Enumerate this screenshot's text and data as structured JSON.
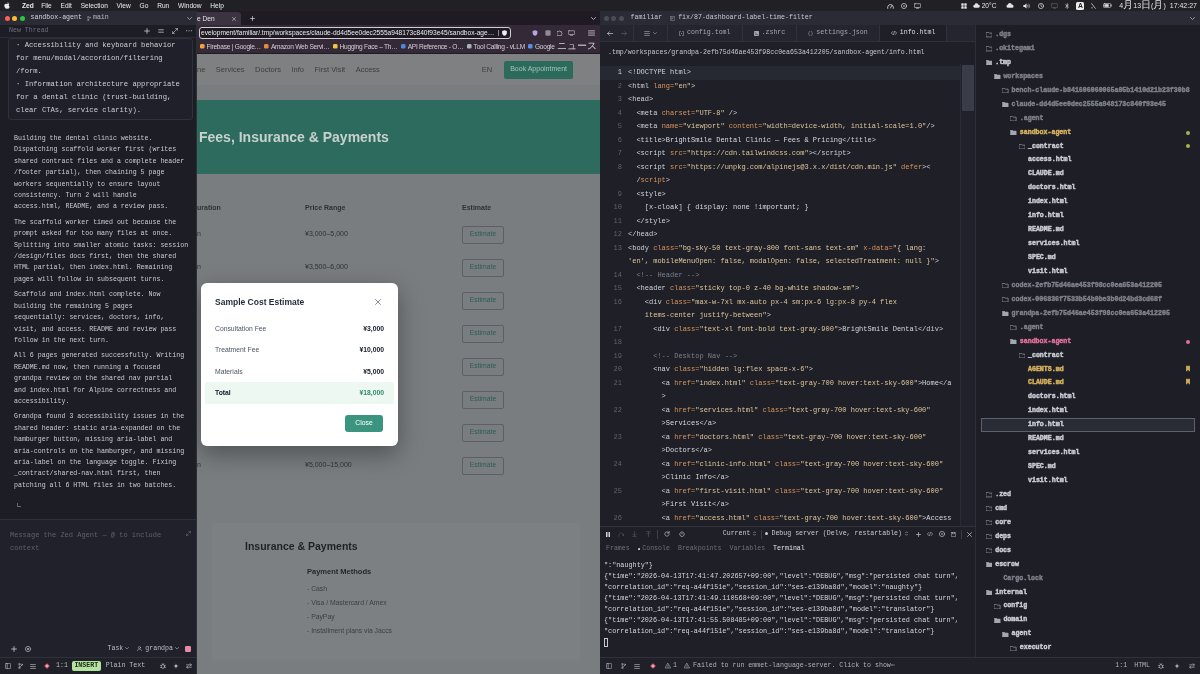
{
  "menu_bar": {
    "app_name": "Zed",
    "menus": [
      "File",
      "Edit",
      "Selection",
      "View",
      "Go",
      "Run",
      "Window",
      "Help"
    ],
    "weather": "20°C",
    "input_source": "A",
    "date": "4月13日(月)",
    "time": "17:42:27"
  },
  "agent_panel": {
    "title_bar": {
      "focused": true,
      "project": "sandbox-agent",
      "branch": "main"
    },
    "thread_title": "New Thread",
    "user_message": "· Accessibility and keyboard behavior\nfor menu/modal/accordion/filtering\n/form.\n· Information architecture appropriate\nfor a dental clinic (trust-building,\nclear CTAs, service clarity).",
    "messages": [
      "Building the dental clinic website.\nDispatching scaffold worker first (writes\nshared contract files and a complete header\n/footer partial), then chaining 5 page\nworkers sequentially to ensure layout\nconsistency. Turn 2 will handle\naccess.html, README, and a review pass.",
      "The scaffold worker timed out because the\nprompt asked for too many files at once.\nSplitting into smaller atomic tasks: session\n/design/files docs first, then the shared\nHTML partial, then index.html. Remaining\npages will follow in subsequent turns.",
      "Scaffold and index.html complete. Now\nbuilding the remaining 5 pages\nsequentially: services, doctors, info,\nvisit, and access. README and review pass\nfollow in the next turn.",
      "All 6 pages generated successfully. Writing\nREADME.md now, then running a focused\ngrandpa review on the shared nav partial\nand index.html for Alpine correctness and\naccessibility.",
      "Grandpa found 3 accessibility issues in the\nshared header: static aria-expanded on the\nhamburger button, missing aria-label and\naria-controls on the hamburger, and missing\naria-label on the language toggle. Fixing\n_contract/shared-nav.html first, then\npatching all 6 HTML files in two batches."
    ],
    "input": {
      "placeholder": "Message the Zed Agent — @ to include context"
    },
    "mode": "Task",
    "profile": "grandpa",
    "status_bar": {
      "position": "1:1",
      "vim_mode": "INSERT",
      "language": "Plain Text"
    }
  },
  "browser": {
    "tab_title": "e Den",
    "url": "evelopment/familiar/.tmp/workspaces/claude-dd4d5ee0dec2555a948173c840f93e45/sandbox-age…",
    "bookmarks": [
      {
        "label": "Firebase | Google…",
        "color": "#f2a33a"
      },
      {
        "label": "Amazon Web Servi…",
        "color": "#e8883a"
      },
      {
        "label": "Hugging Face – Th…",
        "color": "#f3c340"
      },
      {
        "label": "API Reference - O…",
        "color": "#4f86e0"
      },
      {
        "label": "Tool Calling - vLLM",
        "color": "#a9b1bb"
      },
      {
        "label": "Google ニュース",
        "color": "#5a8fe8"
      }
    ],
    "page": {
      "nav_links": [
        "ne",
        "Services",
        "Doctors",
        "Info",
        "First Visit",
        "Access"
      ],
      "language": "EN",
      "cta": "Book Appointment",
      "hero_title": "Fees, Insurance & Payments",
      "table": {
        "columns": [
          "uration",
          "Price Range",
          "Estimate"
        ],
        "rows": [
          {
            "column_1": "n",
            "price": "¥3,000–5,000",
            "action": "Estimate"
          },
          {
            "column_1": "n",
            "price": "¥3,500–6,000",
            "action": "Estimate"
          },
          {
            "action": "Estimate"
          },
          {
            "action": "Estimate"
          },
          {
            "action": "Estimate"
          },
          {
            "action": "Estimate"
          },
          {
            "action": "Estimate"
          },
          {
            "column_1": "n",
            "price": "¥5,000–15,000",
            "action": "Estimate"
          }
        ]
      },
      "payments": {
        "title": "Insurance & Payments",
        "subtitle": "Payment Methods",
        "items": [
          "- Cash",
          "- Visa / Mastercard / Amex",
          "- PayPay",
          "- Installment plans via Jaccs"
        ]
      }
    },
    "modal": {
      "title": "Sample Cost Estimate",
      "items": [
        {
          "kind": "item",
          "label": "Consultation Fee",
          "value": "¥3,000"
        },
        {
          "kind": "item",
          "label": "Treatment Fee",
          "value": "¥10,000"
        },
        {
          "kind": "item",
          "label": "Materials",
          "value": "¥5,000"
        },
        {
          "kind": "total",
          "label": "Total",
          "value": "¥18,000"
        }
      ],
      "button": "Close"
    }
  },
  "editor": {
    "title_bar": {
      "focused": false,
      "project": "familiar",
      "branch": "fix/87-dashboard-label-time-filter"
    },
    "tabs": [
      {
        "label": "config.toml",
        "kind": "config",
        "selected": false
      },
      {
        "label": ".zshrc",
        "kind": "shell",
        "selected": false
      },
      {
        "label": "settings.json",
        "kind": "json",
        "selected": false
      },
      {
        "label": "info.html",
        "kind": "html",
        "selected": true
      }
    ],
    "breadcrumb": ".tmp/workspaces/grandpa-2efb75d46ae453f98cc0ea653a412205/sandbox-agent/info.html",
    "code_lines": [
      {
        "number": "1",
        "current": true,
        "rows": [
          "<!DOCTYPE html>"
        ]
      },
      {
        "number": "2",
        "current": false,
        "rows": [
          "<html lang=\"en\">"
        ]
      },
      {
        "number": "3",
        "current": false,
        "rows": [
          "<head>"
        ]
      },
      {
        "number": "4",
        "current": false,
        "rows": [
          "  <meta charset=\"UTF-8\" />"
        ]
      },
      {
        "number": "5",
        "current": false,
        "rows": [
          "  <meta name=\"viewport\" content=\"width=device-width, initial-scale=1.0\"/>"
        ]
      },
      {
        "number": "6",
        "current": false,
        "rows": [
          "  <title>BrightSmile Dental Clinic — Fees & Pricing</title>"
        ]
      },
      {
        "number": "7",
        "current": false,
        "rows": [
          "  <script src=\"https://cdn.tailwindcss.com\"></script>"
        ]
      },
      {
        "number": "8",
        "current": false,
        "rows": [
          "  <script src=\"https://unpkg.com/alpinejs@3.x.x/dist/cdn.min.js\" defer><",
          "  /script>"
        ]
      },
      {
        "number": "9",
        "current": false,
        "rows": [
          "  <style>"
        ]
      },
      {
        "number": "10",
        "current": false,
        "rows": [
          "    [x-cloak] { display: none !important; }"
        ]
      },
      {
        "number": "11",
        "current": false,
        "rows": [
          "  </style>"
        ]
      },
      {
        "number": "12",
        "current": false,
        "rows": [
          "</head>"
        ]
      },
      {
        "number": "13",
        "current": false,
        "rows": [
          "<body class=\"bg-sky-50 text-gray-800 font-sans text-sm\" x-data=\"{ lang:",
          "'en', mobileMenuOpen: false, modalOpen: false, selectedTreatment: null }\">"
        ]
      },
      {
        "number": "14",
        "current": false,
        "rows": [
          "  <!-- Header -->"
        ]
      },
      {
        "number": "15",
        "current": false,
        "rows": [
          "  <header class=\"sticky top-0 z-40 bg-white shadow-sm\">"
        ]
      },
      {
        "number": "16",
        "current": false,
        "rows": [
          "    <div class=\"max-w-7xl mx-auto px-4 sm:px-6 lg:px-8 py-4 flex",
          "    items-center justify-between\">"
        ]
      },
      {
        "number": "17",
        "current": false,
        "rows": [
          "      <div class=\"text-xl font-bold text-gray-900\">BrightSmile Dental</div>"
        ]
      },
      {
        "number": "18",
        "current": false
      },
      {
        "number": "19",
        "current": false,
        "rows": [
          "      <!-- Desktop Nav -->"
        ]
      },
      {
        "number": "20",
        "current": false,
        "rows": [
          "      <nav class=\"hidden lg:flex space-x-6\">"
        ]
      },
      {
        "number": "21",
        "current": false,
        "rows": [
          "        <a href=\"index.html\" class=\"text-gray-700 hover:text-sky-600\">Home</a",
          "        >"
        ]
      },
      {
        "number": "22",
        "current": false,
        "rows": [
          "        <a href=\"services.html\" class=\"text-gray-700 hover:text-sky-600\"",
          "        >Services</a>"
        ]
      },
      {
        "number": "23",
        "current": false,
        "rows": [
          "        <a href=\"doctors.html\" class=\"text-gray-700 hover:text-sky-600\"",
          "        >Doctors</a>"
        ]
      },
      {
        "number": "24",
        "current": false,
        "rows": [
          "        <a href=\"clinic-info.html\" class=\"text-gray-700 hover:text-sky-600\"",
          "        >Clinic Info</a>"
        ]
      },
      {
        "number": "25",
        "current": false,
        "rows": [
          "        <a href=\"first-visit.html\" class=\"text-gray-700 hover:text-sky-600\"",
          "        >First Visit</a>"
        ]
      },
      {
        "number": "26",
        "current": false,
        "rows": [
          "        <a href=\"access.html\" class=\"text-gray-700 hover:text-sky-600\">Access"
        ]
      }
    ],
    "debug": {
      "session": "Current",
      "server": "Debug server (Delve, restartable)",
      "tabs": [
        {
          "label": "Frames",
          "dot": false,
          "selected": false
        },
        {
          "label": "Console",
          "dot": true,
          "selected": false
        },
        {
          "label": "Breakpoints",
          "dot": false,
          "selected": false
        },
        {
          "label": "Variables",
          "dot": false,
          "selected": false
        },
        {
          "label": "Terminal",
          "dot": false,
          "selected": true
        }
      ],
      "terminal_lines": [
        "\":\"naughty\"}",
        "{\"time\":\"2026-04-13T17:41:47.202657+09:00\",\"level\":\"DEBUG\",\"msg\":\"persisted chat turn\",",
        "\"correlation_id\":\"req-a44f151e\",\"session_id\":\"ses-e139ba8d\",\"model\":\"naughty\"}",
        "{\"time\":\"2026-04-13T17:41:49.110568+09:00\",\"level\":\"DEBUG\",\"msg\":\"persisted chat turn\",",
        "\"correlation_id\":\"req-a44f151e\",\"session_id\":\"ses-e139ba8d\",\"model\":\"translator\"}",
        "{\"time\":\"2026-04-13T17:41:55.508485+09:00\",\"level\":\"DEBUG\",\"msg\":\"persisted chat turn\",",
        "\"correlation_id\":\"req-a44f151e\",\"session_id\":\"ses-e139ba8d\",\"model\":\"translator\"}"
      ]
    },
    "project_tree": [
      {
        "name": ".dgs",
        "kind": "folder",
        "expanded": false,
        "selected": false,
        "color": "#7d808a"
      },
      {
        "name": ".okitegami",
        "kind": "folder",
        "expanded": false,
        "selected": false,
        "color": "#7d808a"
      },
      {
        "name": ".tmp",
        "kind": "folder",
        "expanded": true,
        "selected": false,
        "color": "#c9ccd3",
        "children": [
          {
            "name": "workspaces",
            "kind": "folder",
            "expanded": true,
            "selected": false,
            "color": "#7d808a",
            "children": [
              {
                "name": "bench-claude-b841606060065a05b1410d21b23f30b8",
                "kind": "folder",
                "expanded": false,
                "selected": false,
                "color": "#7d808a"
              },
              {
                "name": "claude-dd4d5ee0dec2555a948173c840f93e45",
                "kind": "folder",
                "expanded": true,
                "selected": false,
                "color": "#7d808a",
                "children": [
                  {
                    "name": ".agent",
                    "kind": "folder",
                    "expanded": false,
                    "selected": false,
                    "color": "#7d808a"
                  },
                  {
                    "name": "sandbox-agent",
                    "kind": "folder",
                    "expanded": true,
                    "selected": false,
                    "color": "#d7b35c",
                    "dot": {
                      "color": "#a9b04e"
                    },
                    "children": [
                      {
                        "name": "_contract",
                        "kind": "folder",
                        "expanded": false,
                        "selected": false,
                        "color": "#c9ccd3",
                        "dot": {
                          "color": "#a9b04e"
                        }
                      },
                      {
                        "name": "access.html",
                        "kind": "file",
                        "selected": false,
                        "color": "#c9ccd3"
                      },
                      {
                        "name": "CLAUDE.md",
                        "kind": "file",
                        "selected": false,
                        "color": "#c9ccd3"
                      },
                      {
                        "name": "doctors.html",
                        "kind": "file",
                        "selected": false,
                        "color": "#c9ccd3"
                      },
                      {
                        "name": "index.html",
                        "kind": "file",
                        "selected": false,
                        "color": "#c9ccd3"
                      },
                      {
                        "name": "info.html",
                        "kind": "file",
                        "selected": false,
                        "color": "#c9ccd3"
                      },
                      {
                        "name": "README.md",
                        "kind": "file",
                        "selected": false,
                        "color": "#c9ccd3"
                      },
                      {
                        "name": "services.html",
                        "kind": "file",
                        "selected": false,
                        "color": "#c9ccd3"
                      },
                      {
                        "name": "SPEC.md",
                        "kind": "file",
                        "selected": false,
                        "color": "#c9ccd3"
                      },
                      {
                        "name": "visit.html",
                        "kind": "file",
                        "selected": false,
                        "color": "#c9ccd3"
                      }
                    ]
                  }
                ]
              },
              {
                "name": "codex-2efb75d46ae453f98cc0ea653a412205",
                "kind": "folder",
                "expanded": false,
                "selected": false,
                "color": "#7d808a"
              },
              {
                "name": "codex-006836f7533b54b0be3b0d24bd3cd68f",
                "kind": "folder",
                "expanded": false,
                "selected": false,
                "color": "#7d808a"
              },
              {
                "name": "grandpa-2efb75d46ae453f98cc0ea653a412205",
                "kind": "folder",
                "expanded": true,
                "selected": false,
                "color": "#7d808a",
                "children": [
                  {
                    "name": ".agent",
                    "kind": "folder",
                    "expanded": false,
                    "selected": false,
                    "color": "#7d808a"
                  },
                  {
                    "name": "sandbox-agent",
                    "kind": "folder",
                    "expanded": true,
                    "selected": false,
                    "color": "#e0709a",
                    "dot": {
                      "color": "#e0709a"
                    },
                    "children": [
                      {
                        "name": "_contract",
                        "kind": "folder",
                        "expanded": false,
                        "selected": false,
                        "color": "#c9ccd3"
                      },
                      {
                        "name": "AGENTS.md",
                        "kind": "file",
                        "selected": false,
                        "color": "#d7b35c",
                        "badge": "M"
                      },
                      {
                        "name": "CLAUDE.md",
                        "kind": "file",
                        "selected": false,
                        "color": "#d7b35c",
                        "badge": "M"
                      },
                      {
                        "name": "doctors.html",
                        "kind": "file",
                        "selected": false,
                        "color": "#c9ccd3"
                      },
                      {
                        "name": "index.html",
                        "kind": "file",
                        "selected": false,
                        "color": "#c9ccd3"
                      },
                      {
                        "name": "info.html",
                        "kind": "file",
                        "selected": true,
                        "color": "#c9ccd3"
                      },
                      {
                        "name": "README.md",
                        "kind": "file",
                        "selected": false,
                        "color": "#c9ccd3"
                      },
                      {
                        "name": "services.html",
                        "kind": "file",
                        "selected": false,
                        "color": "#c9ccd3"
                      },
                      {
                        "name": "SPEC.md",
                        "kind": "file",
                        "selected": false,
                        "color": "#c9ccd3"
                      },
                      {
                        "name": "visit.html",
                        "kind": "file",
                        "selected": false,
                        "color": "#c9ccd3"
                      }
                    ]
                  }
                ]
              }
            ]
          }
        ]
      },
      {
        "name": ".zed",
        "kind": "folder",
        "expanded": false,
        "selected": false,
        "color": "#c9ccd3"
      },
      {
        "name": "cmd",
        "kind": "folder",
        "expanded": false,
        "selected": false,
        "color": "#c9ccd3"
      },
      {
        "name": "core",
        "kind": "folder",
        "expanded": false,
        "selected": false,
        "color": "#c9ccd3"
      },
      {
        "name": "deps",
        "kind": "folder",
        "expanded": false,
        "selected": false,
        "color": "#c9ccd3"
      },
      {
        "name": "docs",
        "kind": "folder",
        "expanded": false,
        "selected": false,
        "color": "#c9ccd3"
      },
      {
        "name": "escrow",
        "kind": "folder",
        "expanded": true,
        "selected": false,
        "color": "#c9ccd3",
        "children": [
          {
            "name": "Cargo.lock",
            "kind": "file",
            "selected": false,
            "color": "#7d808a"
          }
        ]
      },
      {
        "name": "internal",
        "kind": "folder",
        "expanded": true,
        "selected": false,
        "color": "#c9ccd3",
        "children": [
          {
            "name": "config",
            "kind": "folder",
            "expanded": false,
            "selected": false,
            "color": "#c9ccd3"
          },
          {
            "name": "domain",
            "kind": "folder",
            "expanded": true,
            "selected": false,
            "color": "#c9ccd3",
            "children": [
              {
                "name": "agent",
                "kind": "folder",
                "expanded": true,
                "selected": false,
                "color": "#c9ccd3",
                "children": [
                  {
                    "name": "executor",
                    "kind": "folder",
                    "expanded": false,
                    "selected": false,
                    "color": "#c9ccd3"
                  }
                ]
              }
            ]
          }
        ]
      }
    ],
    "status_bar": {
      "warning_count": "1",
      "message": "Failed to run emmet-language-server. Click to show⋯",
      "position": "1:1",
      "language": "HTML"
    }
  }
}
